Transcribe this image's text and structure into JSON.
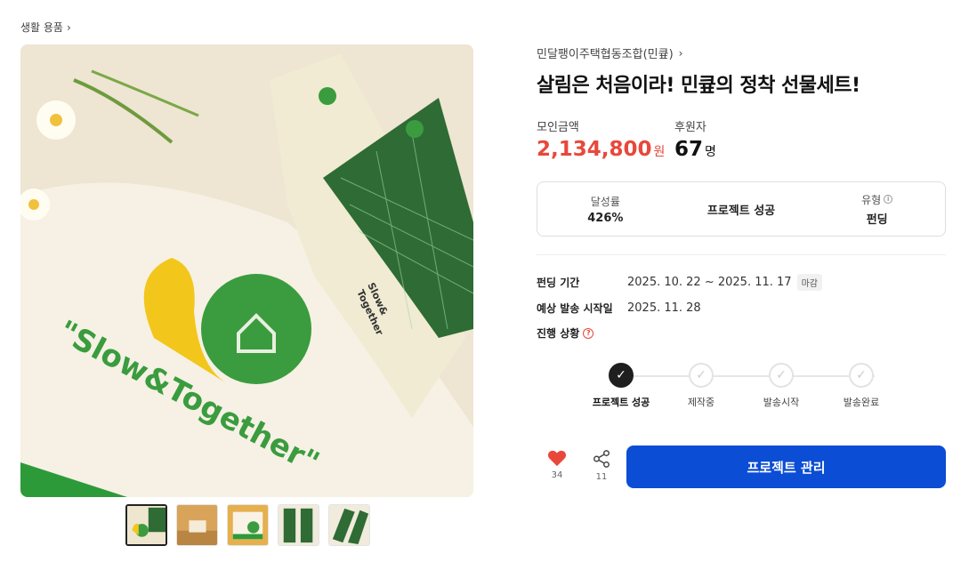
{
  "breadcrumb": {
    "label": "생활 용품"
  },
  "product": {
    "creator": "민달팽이주택협동조합(민큪)",
    "title": "살림은 처음이라! 민큪의 정착 선물세트!"
  },
  "stats": {
    "amount_label": "모인금액",
    "amount_value": "2,134,800",
    "amount_unit": "원",
    "backers_label": "후원자",
    "backers_value": "67",
    "backers_unit": "명"
  },
  "info": {
    "rate_label": "달성률",
    "rate_value": "426%",
    "status_text": "프로젝트 성공",
    "type_label": "유형",
    "type_value": "펀딩"
  },
  "details": {
    "period_label": "펀딩 기간",
    "period_value": "2025. 10. 22 ~ 2025. 11. 17",
    "period_badge": "마감",
    "ship_label": "예상 발송 시작일",
    "ship_value": "2025. 11. 28",
    "progress_label": "진행 상황"
  },
  "steps": [
    {
      "label": "프로젝트 성공",
      "done": true
    },
    {
      "label": "제작중",
      "done": false
    },
    {
      "label": "발송시작",
      "done": false
    },
    {
      "label": "발송완료",
      "done": false
    }
  ],
  "actions": {
    "like_count": "34",
    "share_count": "11",
    "manage_label": "프로젝트 관리"
  },
  "image": {
    "embroidery_text": "\"Slow&Together\"",
    "sock_text_1": "Slow&",
    "sock_text_2": "Together"
  },
  "colors": {
    "accent_red": "#e8483b",
    "primary_blue": "#0b4dd4",
    "brand_green": "#2f8f3a"
  },
  "icons": {
    "chevron": "›",
    "check": "✓",
    "info": "i",
    "question": "?"
  }
}
